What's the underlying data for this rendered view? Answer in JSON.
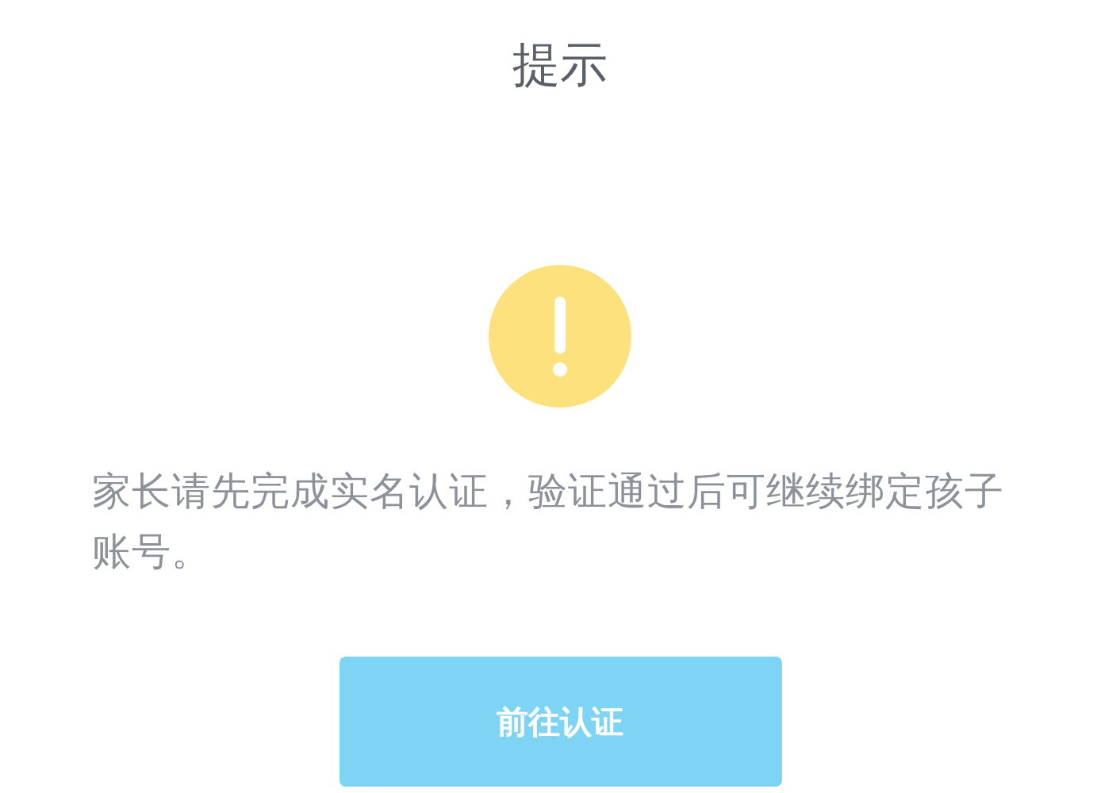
{
  "dialog": {
    "title": "提示",
    "message": "家长请先完成实名认证，验证通过后可继续绑定孩子账号。",
    "buttons": [
      {
        "label": "前往认证",
        "kind": "primary"
      }
    ]
  }
}
